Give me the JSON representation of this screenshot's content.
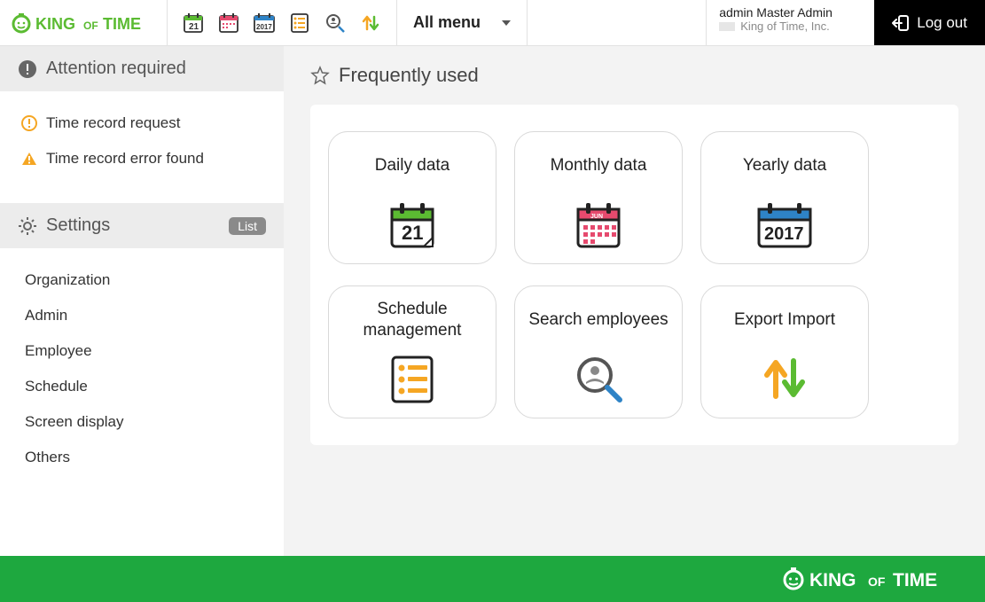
{
  "brand_name": "KING OF TIME",
  "toolbar": {
    "allmenu_label": "All menu"
  },
  "user": {
    "name": "admin Master Admin",
    "company": "King of Time, Inc."
  },
  "logout_label": "Log out",
  "sidebar": {
    "attention_title": "Attention required",
    "attention_items": [
      {
        "label": "Time record request"
      },
      {
        "label": "Time record error found"
      }
    ],
    "settings_title": "Settings",
    "settings_badge": "List",
    "settings_items": [
      {
        "label": "Organization"
      },
      {
        "label": "Admin"
      },
      {
        "label": "Employee"
      },
      {
        "label": "Schedule"
      },
      {
        "label": "Screen display"
      },
      {
        "label": "Others"
      }
    ]
  },
  "main": {
    "freq_title": "Frequently used",
    "cards": [
      {
        "label": "Daily data"
      },
      {
        "label": "Monthly data"
      },
      {
        "label": "Yearly data"
      },
      {
        "label": "Schedule management"
      },
      {
        "label": "Search employees"
      },
      {
        "label": "Export Import"
      }
    ]
  }
}
